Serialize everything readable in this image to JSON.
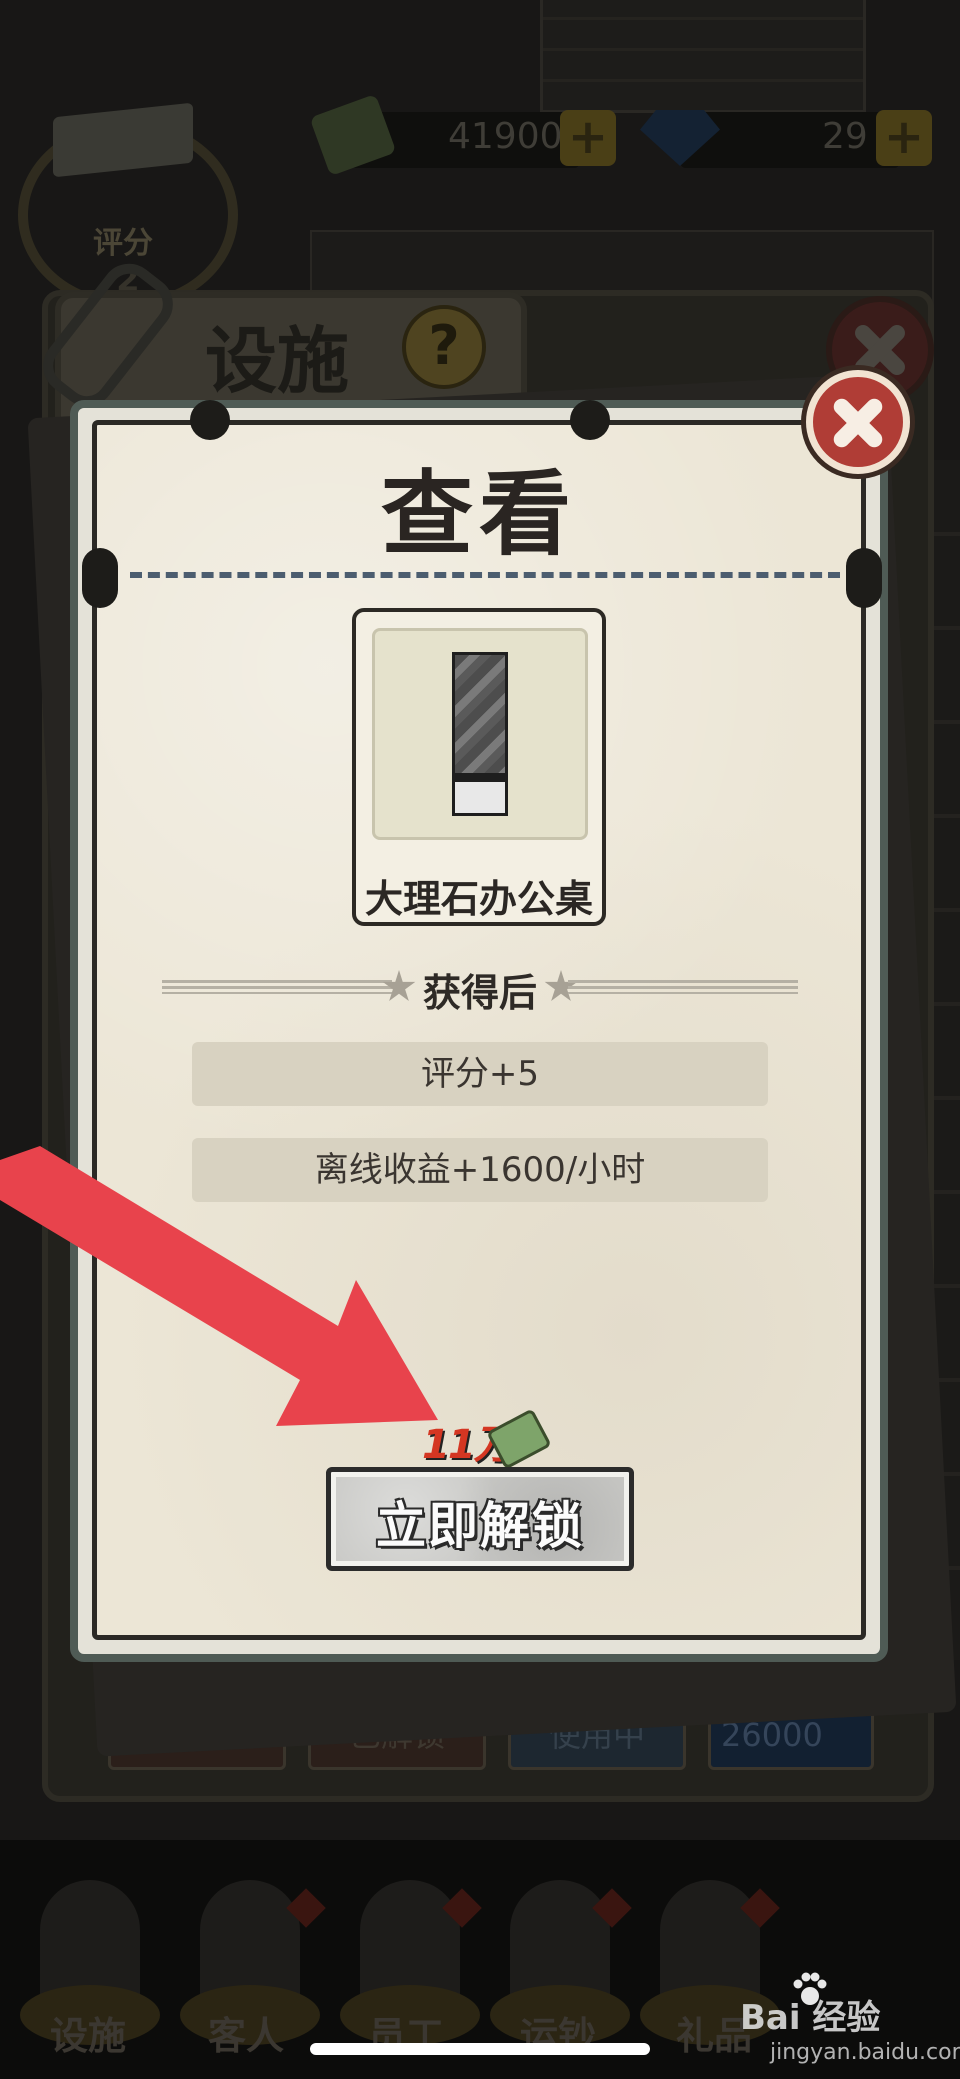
{
  "header": {
    "money_value": "41900",
    "gem_value": "29",
    "plus_label": "+",
    "rating_label": "评分",
    "rating_value": "2"
  },
  "facility_panel": {
    "title": "设施",
    "help_label": "?",
    "slots": [
      {
        "label": "已解锁"
      },
      {
        "label": "已解锁"
      },
      {
        "label": "使用中"
      },
      {
        "label": "26000"
      }
    ]
  },
  "dialog": {
    "title": "查看",
    "item_name": "大理石办公桌",
    "section_title": "获得后",
    "effects": [
      {
        "label": "评分+5"
      },
      {
        "label": "离线收益+1600/小时"
      }
    ],
    "cost": "11万",
    "unlock_button": "立即解锁"
  },
  "bottom_nav": {
    "items": [
      {
        "label": "设施"
      },
      {
        "label": "客人"
      },
      {
        "label": "员工"
      },
      {
        "label": "运钞"
      },
      {
        "label": "礼品"
      }
    ]
  },
  "watermark": {
    "brand": "Bai 经验",
    "url": "jingyan.baidu.com"
  },
  "colors": {
    "accent_red": "#b03d36",
    "cost_red": "#d43622",
    "arrow_red": "#e8434c",
    "paper": "#ece6d6"
  }
}
